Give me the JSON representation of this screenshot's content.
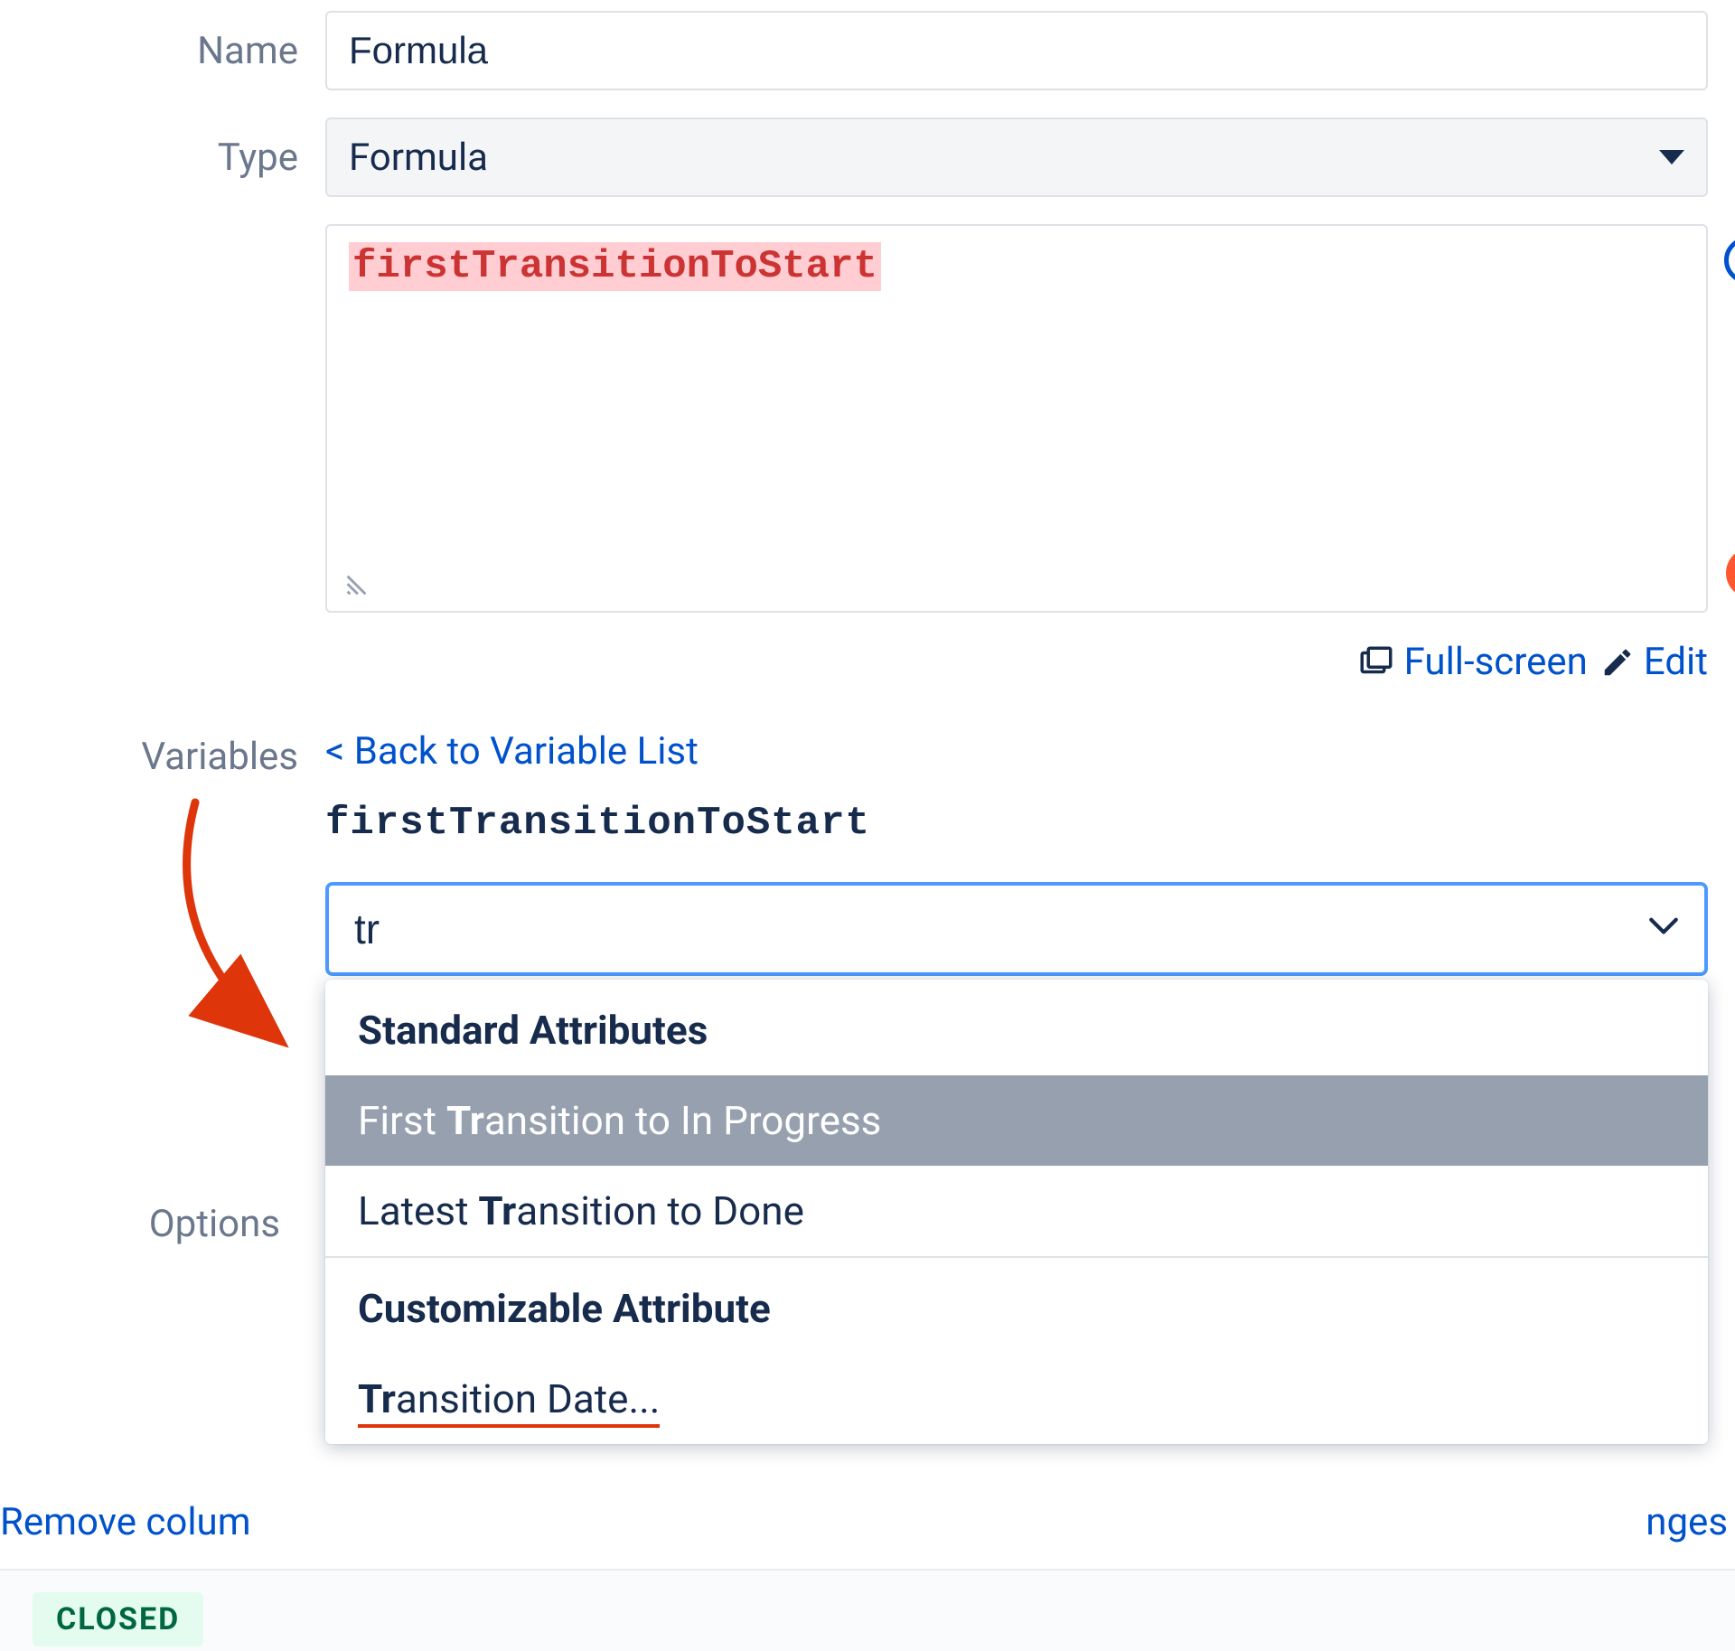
{
  "labels": {
    "name": "Name",
    "type": "Type",
    "variables": "Variables",
    "options": "Options"
  },
  "fields": {
    "name_value": "Formula",
    "type_value": "Formula",
    "formula_text": "firstTransitionToStart"
  },
  "actions": {
    "fullscreen": "Full-screen",
    "edit": "Edit",
    "back": "< Back to Variable List"
  },
  "variable": {
    "name": "firstTransitionToStart",
    "search_value": "tr"
  },
  "dropdown": {
    "group1_header": "Standard Attributes",
    "item1_prefix": "First ",
    "item1_match": "Tr",
    "item1_suffix": "ansition to In Progress",
    "item2_prefix": "Latest ",
    "item2_match": "Tr",
    "item2_suffix": "ansition to Done",
    "group2_header": "Customizable Attribute",
    "item3_match": "Tr",
    "item3_suffix": "ansition Date..."
  },
  "bottom": {
    "remove_column": "Remove colum",
    "changes_suffix": "nges",
    "closed_badge": "CLOSED"
  },
  "icons": {
    "help": "?",
    "warning": "!"
  }
}
